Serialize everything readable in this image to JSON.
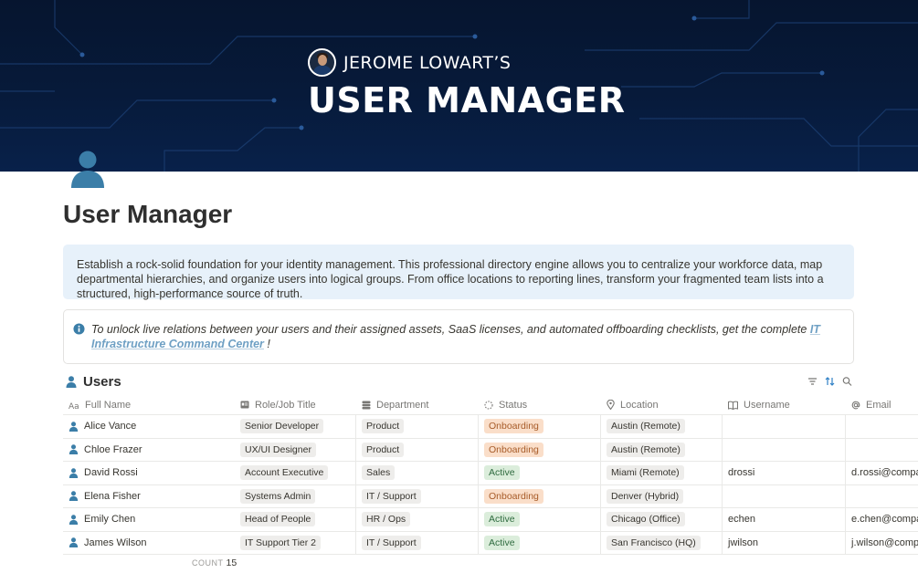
{
  "banner": {
    "author": "JEROME LOWART’S",
    "title": "USER MANAGER"
  },
  "page": {
    "icon": "person-icon",
    "title": "User Manager"
  },
  "description": "Establish a rock-solid foundation for your identity management. This professional directory engine allows you to centralize your workforce data, map departmental hierarchies, and organize users into logical groups. From office locations to reporting lines, transform your fragmented team lists into a structured, high-performance source of truth.",
  "info_callout": {
    "icon": "info-icon",
    "text_before": "To unlock live relations between your users and their assigned assets, SaaS licenses, and automated offboarding checklists, get the complete ",
    "link_text": "IT Infrastructure Command Center",
    "text_after": " !"
  },
  "database": {
    "title": "Users",
    "tools": [
      "filter-icon",
      "sort-icon",
      "search-icon"
    ],
    "columns": [
      {
        "label": "Full Name",
        "icon": "title-icon"
      },
      {
        "label": "Role/Job Title",
        "icon": "id-card-icon"
      },
      {
        "label": "Department",
        "icon": "database-icon"
      },
      {
        "label": "Status",
        "icon": "status-icon"
      },
      {
        "label": "Location",
        "icon": "pin-icon"
      },
      {
        "label": "Username",
        "icon": "book-icon"
      },
      {
        "label": "Email",
        "icon": "at-icon"
      }
    ],
    "rows": [
      {
        "name": "Alice Vance",
        "role": "Senior Developer",
        "department": "Product",
        "status": "Onboarding",
        "location": "Austin (Remote)",
        "username": "",
        "email": ""
      },
      {
        "name": "Chloe Frazer",
        "role": "UX/UI Designer",
        "department": "Product",
        "status": "Onboarding",
        "location": "Austin (Remote)",
        "username": "",
        "email": ""
      },
      {
        "name": "David Rossi",
        "role": "Account Executive",
        "department": "Sales",
        "status": "Active",
        "location": "Miami (Remote)",
        "username": "drossi",
        "email": "d.rossi@company"
      },
      {
        "name": "Elena Fisher",
        "role": "Systems Admin",
        "department": "IT / Support",
        "status": "Onboarding",
        "location": "Denver (Hybrid)",
        "username": "",
        "email": ""
      },
      {
        "name": "Emily Chen",
        "role": "Head of People",
        "department": "HR / Ops",
        "status": "Active",
        "location": "Chicago (Office)",
        "username": "echen",
        "email": "e.chen@company"
      },
      {
        "name": "James Wilson",
        "role": "IT Support Tier 2",
        "department": "IT / Support",
        "status": "Active",
        "location": "San Francisco (HQ)",
        "username": "jwilson",
        "email": "j.wilson@company"
      }
    ],
    "count_label": "COUNT",
    "count_value": "15"
  },
  "colors": {
    "banner_bg": "#071a3a",
    "callout_bg": "#e7f1fa",
    "person_icon": "#3b7ea8",
    "onboarding_bg": "#fadec9",
    "active_bg": "#dbeddb"
  }
}
